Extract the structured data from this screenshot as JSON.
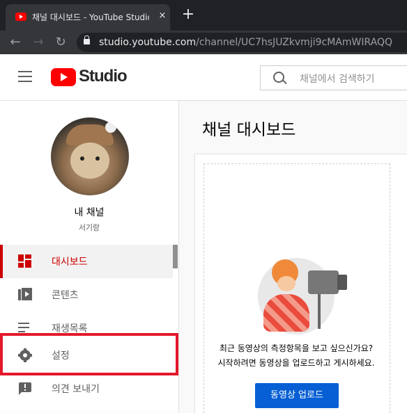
{
  "browser": {
    "tab_title": "채널 대시보드 - YouTube Studio",
    "close_symbol": "×",
    "new_tab_symbol": "+",
    "back_symbol": "←",
    "forward_symbol": "→",
    "reload_symbol": "↻",
    "url_host": "studio.youtube.com",
    "url_path": "/channel/UC7hsJUZkvmji9cMAmWIRAQQ"
  },
  "header": {
    "logo_text": "Studio",
    "search_placeholder": "채널에서 검색하기"
  },
  "sidebar": {
    "channel_name": "내 채널",
    "channel_handle": "서기랑",
    "items": [
      {
        "label": "대시보드",
        "icon": "dashboard-icon",
        "active": true
      },
      {
        "label": "콘텐츠",
        "icon": "content-icon",
        "active": false
      },
      {
        "label": "재생목록",
        "icon": "playlist-icon",
        "active": false
      },
      {
        "label": "설정",
        "icon": "gear-icon",
        "active": false
      },
      {
        "label": "의견 보내기",
        "icon": "feedback-icon",
        "active": false
      }
    ]
  },
  "main": {
    "title": "채널 대시보드",
    "prompt_line1": "최근 동영상의 측정항목을 보고 싶으신가요?",
    "prompt_line2": "시작하려면 동영상을 업로드하고 게시하세요.",
    "upload_button": "동영상 업로드"
  },
  "colors": {
    "accent_red": "#cc0000",
    "highlight_red": "#e4182b",
    "upload_blue": "#065fd4"
  }
}
